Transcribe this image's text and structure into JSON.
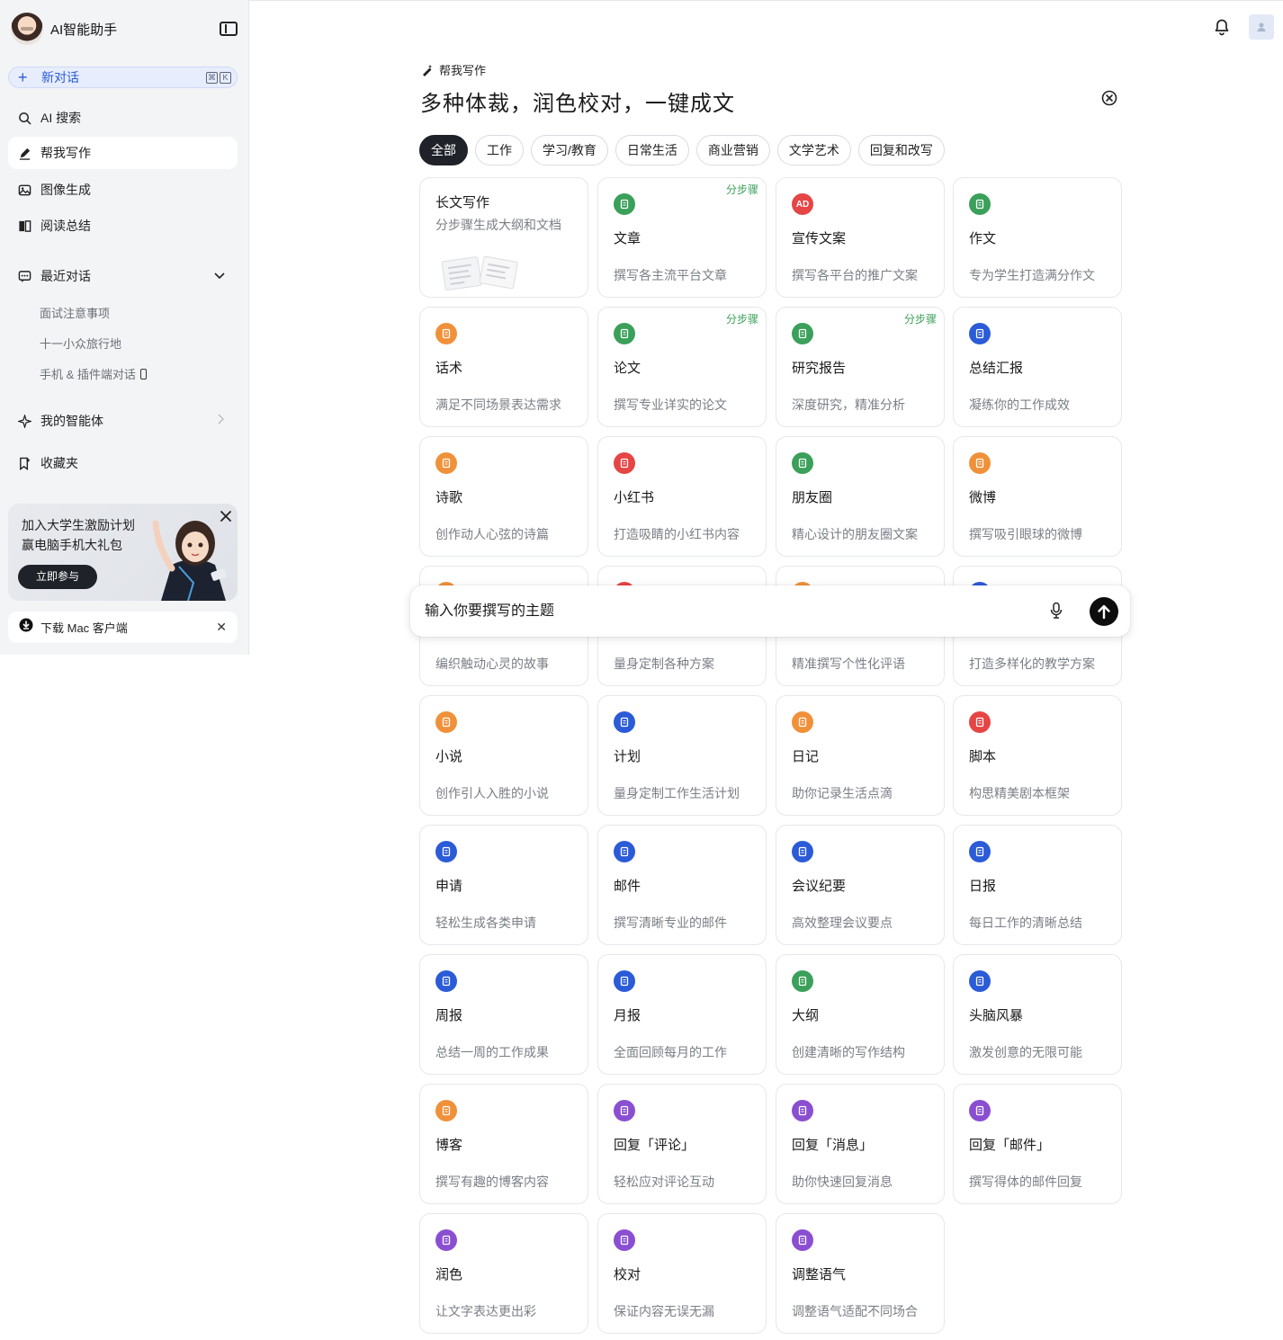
{
  "sidebar": {
    "app_title": "AI智能助手",
    "new_chat": {
      "label": "新对话",
      "shortcut": [
        "⌘",
        "K"
      ]
    },
    "nav": [
      {
        "label": "AI 搜索",
        "icon": "search-icon"
      },
      {
        "label": "帮我写作",
        "icon": "pen-icon"
      },
      {
        "label": "图像生成",
        "icon": "image-icon"
      },
      {
        "label": "阅读总结",
        "icon": "book-icon"
      }
    ],
    "recent": {
      "label": "最近对话",
      "items": [
        "面试注意事项",
        "十一小众旅行地",
        "手机 & 插件端对话"
      ]
    },
    "agents_label": "我的智能体",
    "favorites_label": "收藏夹",
    "promo": {
      "line1": "加入大学生激励计划",
      "line2": "赢电脑手机大礼包",
      "button": "立即参与"
    },
    "download": {
      "label": "下载 Mac 客户端"
    }
  },
  "main": {
    "breadcrumb": "帮我写作",
    "title": "多种体裁，润色校对，一键成文",
    "tabs": [
      "全部",
      "工作",
      "学习/教育",
      "日常生活",
      "商业营销",
      "文学艺术",
      "回复和改写"
    ],
    "active_tab": "全部",
    "step_tag": "分步骤",
    "long_card": {
      "title": "长文写作",
      "desc": "分步骤生成大纲和文档"
    },
    "cards": [
      {
        "title": "文章",
        "desc": "撰写各主流平台文章",
        "color": "#3aa05a",
        "icon": "document-icon",
        "tag": true
      },
      {
        "title": "宣传文案",
        "desc": "撰写各平台的推广文案",
        "color": "#e64545",
        "icon": "ad-icon",
        "glyph": "AD"
      },
      {
        "title": "作文",
        "desc": "专为学生打造满分作文",
        "color": "#3aa05a",
        "icon": "pencil-icon"
      },
      {
        "title": "话术",
        "desc": "满足不同场景表达需求",
        "color": "#f0913a",
        "icon": "person-chat-icon"
      },
      {
        "title": "论文",
        "desc": "撰写专业详实的论文",
        "color": "#3aa05a",
        "icon": "chart-icon",
        "tag": true
      },
      {
        "title": "研究报告",
        "desc": "深度研究，精准分析",
        "color": "#3aa05a",
        "icon": "report-icon",
        "tag": true
      },
      {
        "title": "总结汇报",
        "desc": "凝练你的工作成效",
        "color": "#2b5bd7",
        "icon": "summary-icon"
      },
      {
        "title": "诗歌",
        "desc": "创作动人心弦的诗篇",
        "color": "#f0913a",
        "icon": "poem-icon"
      },
      {
        "title": "小红书",
        "desc": "打造吸睛的小红书内容",
        "color": "#e64545",
        "icon": "picture-icon"
      },
      {
        "title": "朋友圈",
        "desc": "精心设计的朋友圈文案",
        "color": "#3aa05a",
        "icon": "picture-icon"
      },
      {
        "title": "微博",
        "desc": "撰写吸引眼球的微博",
        "color": "#f0913a",
        "icon": "picture-icon"
      },
      {
        "title": "",
        "desc": "编织触动心灵的故事",
        "color": "#f0913a",
        "icon": "story-icon"
      },
      {
        "title": "",
        "desc": "量身定制各种方案",
        "color": "#e64545",
        "icon": "plan-icon"
      },
      {
        "title": "",
        "desc": "精准撰写个性化评语",
        "color": "#f0913a",
        "icon": "comment-icon"
      },
      {
        "title": "",
        "desc": "打造多样化的教学方案",
        "color": "#2b5bd7",
        "icon": "teach-icon"
      },
      {
        "title": "小说",
        "desc": "创作引人入胜的小说",
        "color": "#f0913a",
        "icon": "novel-icon"
      },
      {
        "title": "计划",
        "desc": "量身定制工作生活计划",
        "color": "#2b5bd7",
        "icon": "list-icon"
      },
      {
        "title": "日记",
        "desc": "助你记录生活点滴",
        "color": "#f0913a",
        "icon": "diary-icon"
      },
      {
        "title": "脚本",
        "desc": "构思精美剧本框架",
        "color": "#e64545",
        "icon": "clapper-icon"
      },
      {
        "title": "申请",
        "desc": "轻松生成各类申请",
        "color": "#2b5bd7",
        "icon": "form-icon"
      },
      {
        "title": "邮件",
        "desc": "撰写清晰专业的邮件",
        "color": "#2b5bd7",
        "icon": "mail-icon"
      },
      {
        "title": "会议纪要",
        "desc": "高效整理会议要点",
        "color": "#2b5bd7",
        "icon": "notes-icon"
      },
      {
        "title": "日报",
        "desc": "每日工作的清晰总结",
        "color": "#2b5bd7",
        "icon": "calendar-icon"
      },
      {
        "title": "周报",
        "desc": "总结一周的工作成果",
        "color": "#2b5bd7",
        "icon": "calendar-icon"
      },
      {
        "title": "月报",
        "desc": "全面回顾每月的工作",
        "color": "#2b5bd7",
        "icon": "calendar-icon"
      },
      {
        "title": "大纲",
        "desc": "创建清晰的写作结构",
        "color": "#3aa05a",
        "icon": "outline-icon"
      },
      {
        "title": "头脑风暴",
        "desc": "激发创意的无限可能",
        "color": "#2b5bd7",
        "icon": "bulb-icon"
      },
      {
        "title": "博客",
        "desc": "撰写有趣的博客内容",
        "color": "#f0913a",
        "icon": "blog-icon"
      },
      {
        "title": "回复「评论」",
        "desc": "轻松应对评论互动",
        "color": "#8a4fd1",
        "icon": "reply-comment-icon"
      },
      {
        "title": "回复「消息」",
        "desc": "助你快速回复消息",
        "color": "#8a4fd1",
        "icon": "message-icon"
      },
      {
        "title": "回复「邮件」",
        "desc": "撰写得体的邮件回复",
        "color": "#8a4fd1",
        "icon": "reply-mail-icon"
      },
      {
        "title": "润色",
        "desc": "让文字表达更出彩",
        "color": "#8a4fd1",
        "icon": "polish-icon"
      },
      {
        "title": "校对",
        "desc": "保证内容无误无漏",
        "color": "#8a4fd1",
        "icon": "proofread-icon"
      },
      {
        "title": "调整语气",
        "desc": "调整语气适配不同场合",
        "color": "#8a4fd1",
        "icon": "tone-icon"
      }
    ],
    "input": {
      "placeholder": "输入你要撰写的主题"
    }
  }
}
